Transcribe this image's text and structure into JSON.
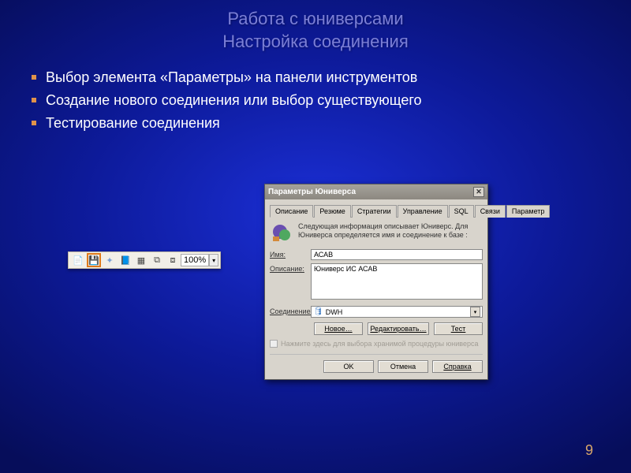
{
  "slide": {
    "title_line1": "Работа с юниверсами",
    "title_line2": "Настройка соединения",
    "bullets": [
      "Выбор элемента «Параметры» на панели инструментов",
      "Создание нового соединения или выбор существующего",
      "Тестирование соединения"
    ],
    "page_number": "9"
  },
  "toolbar": {
    "zoom": "100%"
  },
  "dialog": {
    "title": "Параметры Юниверса",
    "tabs": [
      "Описание",
      "Резюме",
      "Стратегии",
      "Управление",
      "SQL",
      "Связи",
      "Параметр"
    ],
    "active_tab": 0,
    "info_text": "Следующая информация описывает Юниверс. Для Юниверса определяется имя и соединение к базе :",
    "name_label": "Имя:",
    "name_value": "АСАВ",
    "desc_label": "Описание:",
    "desc_value": "Юниверс ИС АСАВ",
    "conn_label": "Соединение:",
    "conn_value": "DWH",
    "btn_new": "Новое…",
    "btn_edit": "Редактировать…",
    "btn_test": "Тест",
    "checkbox_label": "Нажмите здесь для выбора хранимой процедуры юниверса",
    "btn_ok": "OK",
    "btn_cancel": "Отмена",
    "btn_help": "Справка"
  }
}
